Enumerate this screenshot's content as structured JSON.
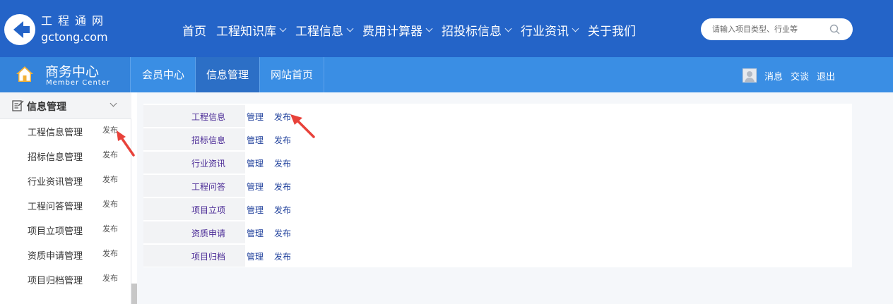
{
  "header": {
    "logo_cn": "工程通网",
    "logo_en": "gctong.com",
    "nav": [
      {
        "label": "首页",
        "has_dropdown": false
      },
      {
        "label": "工程知识库",
        "has_dropdown": true
      },
      {
        "label": "工程信息",
        "has_dropdown": true
      },
      {
        "label": "费用计算器",
        "has_dropdown": true
      },
      {
        "label": "招投标信息",
        "has_dropdown": true
      },
      {
        "label": "行业资讯",
        "has_dropdown": true
      },
      {
        "label": "关于我们",
        "has_dropdown": false
      }
    ],
    "search": {
      "placeholder": "请输入项目类型、行业等",
      "icon": "search-icon"
    }
  },
  "subheader": {
    "title": "商务中心",
    "subtitle": "Member Center",
    "home_icon": "home-icon",
    "tabs": [
      {
        "label": "会员中心",
        "active": false
      },
      {
        "label": "信息管理",
        "active": true
      },
      {
        "label": "网站首页",
        "active": false
      }
    ],
    "user_links": {
      "messages": "消息",
      "chat": "交谈",
      "logout": "退出"
    }
  },
  "sidebar": {
    "section_title": "信息管理",
    "section_icon": "note-icon",
    "items": [
      {
        "label": "工程信息管理",
        "action": "发布"
      },
      {
        "label": "招标信息管理",
        "action": "发布"
      },
      {
        "label": "行业资讯管理",
        "action": "发布"
      },
      {
        "label": "工程问答管理",
        "action": "发布"
      },
      {
        "label": "项目立项管理",
        "action": "发布"
      },
      {
        "label": "资质申请管理",
        "action": "发布"
      },
      {
        "label": "项目归档管理",
        "action": "发布"
      }
    ]
  },
  "main": {
    "rows": [
      {
        "category": "工程信息",
        "manage": "管理",
        "publish": "发布"
      },
      {
        "category": "招标信息",
        "manage": "管理",
        "publish": "发布"
      },
      {
        "category": "行业资讯",
        "manage": "管理",
        "publish": "发布"
      },
      {
        "category": "工程问答",
        "manage": "管理",
        "publish": "发布"
      },
      {
        "category": "项目立项",
        "manage": "管理",
        "publish": "发布"
      },
      {
        "category": "资质申请",
        "manage": "管理",
        "publish": "发布"
      },
      {
        "category": "项目归档",
        "manage": "管理",
        "publish": "发布"
      }
    ]
  },
  "colors": {
    "header_bg": "#2464c8",
    "subbar_bg": "#3a8ee4",
    "active_tab": "#2c6fc6",
    "link": "#1e3f9b",
    "category_text": "#4b2b96",
    "annotation_arrow": "#e8423a"
  }
}
